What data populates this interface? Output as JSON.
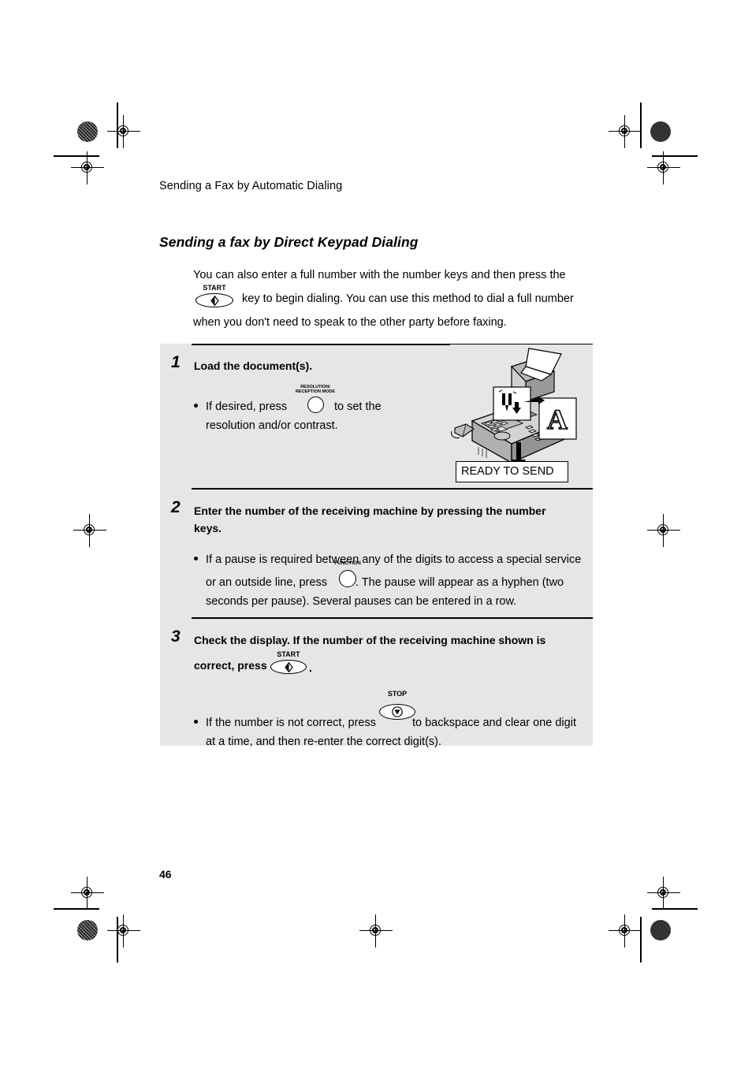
{
  "page": {
    "running_head": "Sending a Fax by Automatic Dialing",
    "section_title": "Sending a fax by Direct Keypad Dialing",
    "page_number": "46"
  },
  "intro": {
    "part1": "You can also enter a full number with the number keys and then press the",
    "part2": "key to begin dialing. You can use this method to dial a full number",
    "part3": "when you don't need to speak to the other party before faxing."
  },
  "keys": {
    "start": {
      "label": "START",
      "glyph": "start-diamond-icon"
    },
    "stop": {
      "label": "STOP",
      "glyph": "stop-triangle-icon"
    },
    "function": {
      "label": "FUNCTION",
      "glyph": "blank-round-key"
    },
    "resolution": {
      "label_line1": "RESOLUTION/",
      "label_line2": "RECEPTION MODE",
      "glyph": "blank-round-key"
    }
  },
  "steps": [
    {
      "number": "1",
      "heading": "Load the document(s).",
      "bullets": [
        {
          "part1": "If desired, press",
          "key": "resolution",
          "part2": "to set the",
          "part3": "resolution and/or contrast."
        }
      ]
    },
    {
      "number": "2",
      "heading_line1": "Enter the number of the receiving machine by pressing the number",
      "heading_line2": "keys.",
      "bullets": [
        {
          "part1": "If a pause is required between any of the digits to access a special service",
          "part2": "or an outside line, press",
          "key": "function",
          "part3": ". The pause will appear as a hyphen (two",
          "part4": "seconds per pause). Several pauses can be entered in a row."
        }
      ]
    },
    {
      "number": "3",
      "heading_line1": "Check the display. If the number of the receiving machine shown is",
      "heading_line2": "correct, press",
      "heading_tail": ".",
      "key": "start",
      "bullets": [
        {
          "part1": "If the number is not correct, press",
          "key": "stop",
          "part2": "to backspace and clear one digit",
          "part3": "at a time, and then re-enter the correct digit(s)."
        }
      ]
    }
  ],
  "illustration": {
    "name": "fax-machine-illustration",
    "document_letter": "A",
    "display_text": "READY TO SEND"
  },
  "colors": {
    "panel_background": "#e6e6e6",
    "page_background": "#ffffff",
    "ink": "#000000"
  }
}
